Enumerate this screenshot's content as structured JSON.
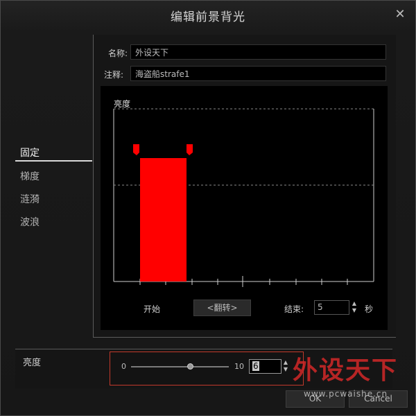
{
  "dialog": {
    "title": "编辑前景背光"
  },
  "fields": {
    "name_label": "名称:",
    "name_value": "外设天下",
    "note_label": "注释:",
    "note_value": "海盗船strafe1"
  },
  "sidebar": {
    "items": [
      {
        "label": "固定",
        "active": true
      },
      {
        "label": "梯度",
        "active": false
      },
      {
        "label": "涟漪",
        "active": false
      },
      {
        "label": "波浪",
        "active": false
      }
    ]
  },
  "graph": {
    "y_label": "亮度",
    "bar_color": "#ff0000",
    "start_label": "开始",
    "flip_button": "<翻转>",
    "end_label": "结束:",
    "end_value": "5",
    "unit": "秒"
  },
  "brightness": {
    "label": "亮度",
    "min_label": "0",
    "max_label": "10",
    "value": "6",
    "slider_level": 0.6
  },
  "buttons": {
    "ok": "OK",
    "cancel": "Cancel"
  },
  "watermark": {
    "text": "外设天下",
    "url": "www.pcwaishe.cn"
  },
  "colors": {
    "accent_red": "#ff0000",
    "slider_frame": "#c3392b"
  }
}
